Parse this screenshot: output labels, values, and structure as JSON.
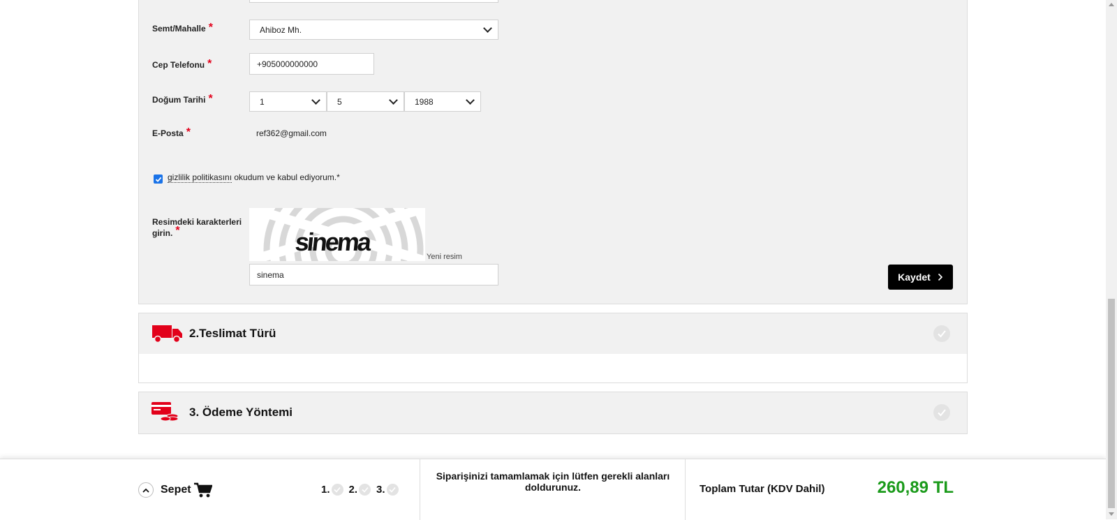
{
  "form": {
    "district": {
      "label": "Semt/Mahalle",
      "value": "Ahiboz Mh."
    },
    "phone": {
      "label": "Cep Telefonu",
      "value": "+905000000000"
    },
    "birthdate": {
      "label": "Doğum Tarihi",
      "day": "1",
      "month": "5",
      "year": "1988"
    },
    "email": {
      "label": "E-Posta",
      "value": "ref362@gmail.com"
    },
    "privacy": {
      "link_text": "gizlilik politikasını",
      "rest_text": " okudum ve kabul ediyorum.*",
      "checked": true
    },
    "captcha": {
      "label_line1": "Resimdeki karakterleri",
      "label_line2": "girin.",
      "image_text": "sinema",
      "new_image_label": "Yeni resim",
      "input_value": "sinema"
    },
    "required_mark": "*",
    "save_label": "Kaydet"
  },
  "sections": [
    {
      "title": "2.Teslimat Türü",
      "icon": "delivery-truck-icon"
    },
    {
      "title": "3. Ödeme Yöntemi",
      "icon": "payment-cards-icon"
    }
  ],
  "footer": {
    "cart_label": "Sepet",
    "steps": [
      "1.",
      "2.",
      "3."
    ],
    "message": "Siparişinizi tamamlamak için lütfen gerekli alanları doldurunuz.",
    "total_label": "Toplam Tutar (KDV Dahil)",
    "total_value": "260,89 TL"
  },
  "colors": {
    "accent": "#e2001a",
    "total": "#1a9a1a",
    "panel": "#f1f1f1",
    "button": "#000000"
  }
}
